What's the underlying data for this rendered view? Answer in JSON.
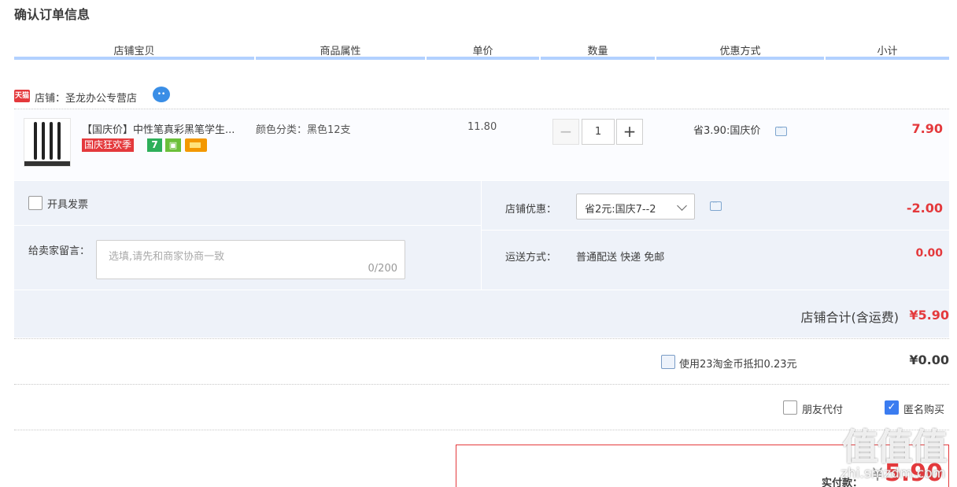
{
  "page": {
    "title": "确认订单信息"
  },
  "columns": [
    "店铺宝贝",
    "商品属性",
    "单价",
    "数量",
    "优惠方式",
    "小计"
  ],
  "shop": {
    "badge": "天猫",
    "label": "店铺：圣龙办公专营店"
  },
  "item": {
    "title": "【国庆价】中性笔真彩黑笔学生...",
    "promo_tag": "国庆狂欢季",
    "icon_7": "7",
    "attribute": "颜色分类：黑色12支",
    "unit_price": "11.80",
    "quantity": "1",
    "minus": "−",
    "plus": "+",
    "discount": "省3.90:国庆价",
    "subtotal": "7.90"
  },
  "invoice": {
    "label": "开具发票",
    "checked": false
  },
  "remark": {
    "label": "给卖家留言：",
    "placeholder": "选填,请先和商家协商一致",
    "count": "0/200"
  },
  "shop_discount": {
    "label": "店铺优惠：",
    "selected": "省2元:国庆7--2",
    "value": "-2.00"
  },
  "shipping": {
    "label": "运送方式：",
    "method": "普通配送 快递 免邮",
    "fee": "0.00"
  },
  "shop_total": {
    "label": "店铺合计(含运费)",
    "value": "¥5.90"
  },
  "coins": {
    "label": "使用23淘金币抵扣0.23元",
    "value": "¥0.00",
    "checked": false
  },
  "options": {
    "friend_pay": "朋友代付",
    "friend_pay_checked": false,
    "anonymous": "匿名购买",
    "anonymous_checked": true,
    "check_mark": "✓"
  },
  "payment": {
    "label": "实付款：",
    "currency": "¥",
    "value": "5.90"
  },
  "watermark": {
    "text": "值值值",
    "sub": "zhi.smzdm.com"
  }
}
